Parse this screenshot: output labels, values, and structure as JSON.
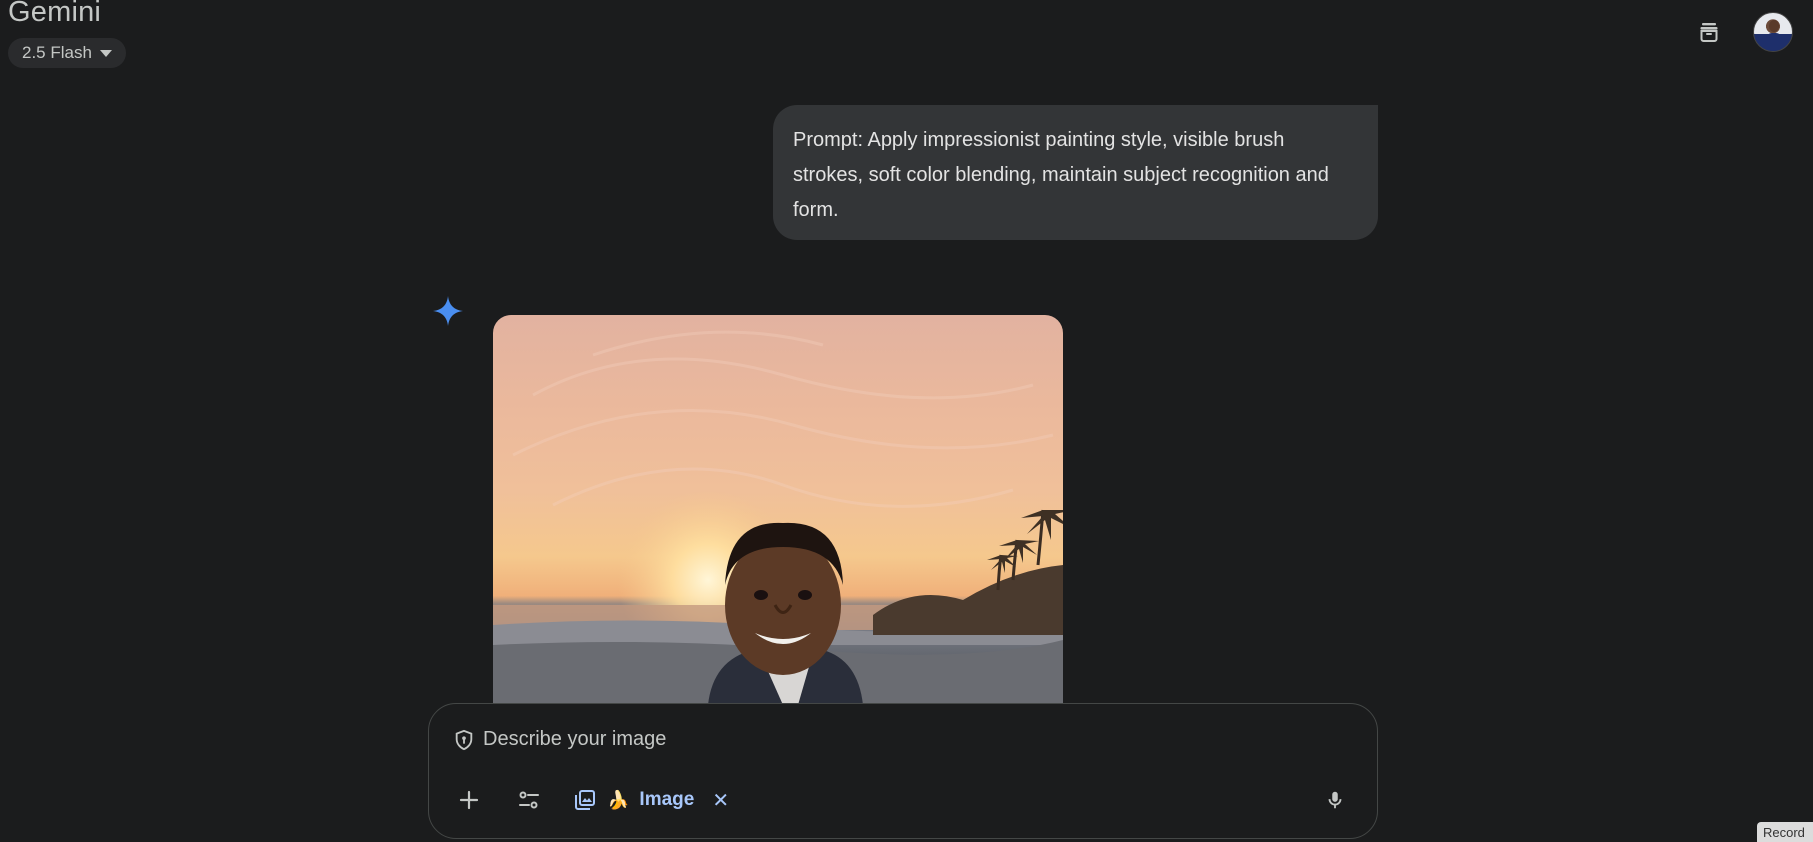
{
  "header": {
    "brand": "Gemini",
    "model": "2.5 Flash",
    "icons": [
      "archive-icon",
      "avatar"
    ]
  },
  "conversation": {
    "user_prompt": "Prompt: Apply impressionist painting style, visible brush strokes, soft color blending, maintain subject recognition and form."
  },
  "composer": {
    "placeholder": "Describe your image",
    "chip_emoji": "🍌",
    "chip_label": "Image",
    "chip_close": "✕"
  },
  "overlay": {
    "record_label": "Record"
  },
  "colors": {
    "background": "#1b1c1d",
    "bubble": "#333537",
    "accent": "#a8c7fa",
    "spark": "#4a8ef0"
  }
}
